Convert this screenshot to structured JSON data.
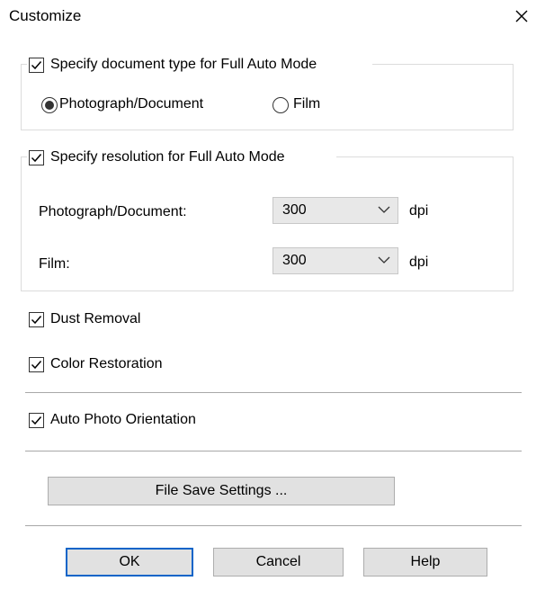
{
  "window": {
    "title": "Customize"
  },
  "doc_type": {
    "checkbox_label": "Specify document type for Full Auto Mode",
    "checked": true,
    "options": [
      {
        "label": "Photograph/Document",
        "selected": true
      },
      {
        "label": "Film",
        "selected": false
      }
    ]
  },
  "resolution": {
    "checkbox_label": "Specify resolution for Full Auto Mode",
    "checked": true,
    "rows": [
      {
        "label": "Photograph/Document:",
        "value": "300",
        "unit": "dpi"
      },
      {
        "label": "Film:",
        "value": "300",
        "unit": "dpi"
      }
    ]
  },
  "options": {
    "dust_removal": {
      "label": "Dust Removal",
      "checked": true
    },
    "color_restoration": {
      "label": "Color Restoration",
      "checked": true
    },
    "auto_photo_orientation": {
      "label": "Auto Photo Orientation",
      "checked": true
    }
  },
  "file_save_settings_label": "File Save Settings ...",
  "buttons": {
    "ok": "OK",
    "cancel": "Cancel",
    "help": "Help"
  },
  "colors": {
    "default_button_border": "#0a64c8",
    "button_face": "#e1e1e1",
    "select_face": "#e8e8e8"
  }
}
